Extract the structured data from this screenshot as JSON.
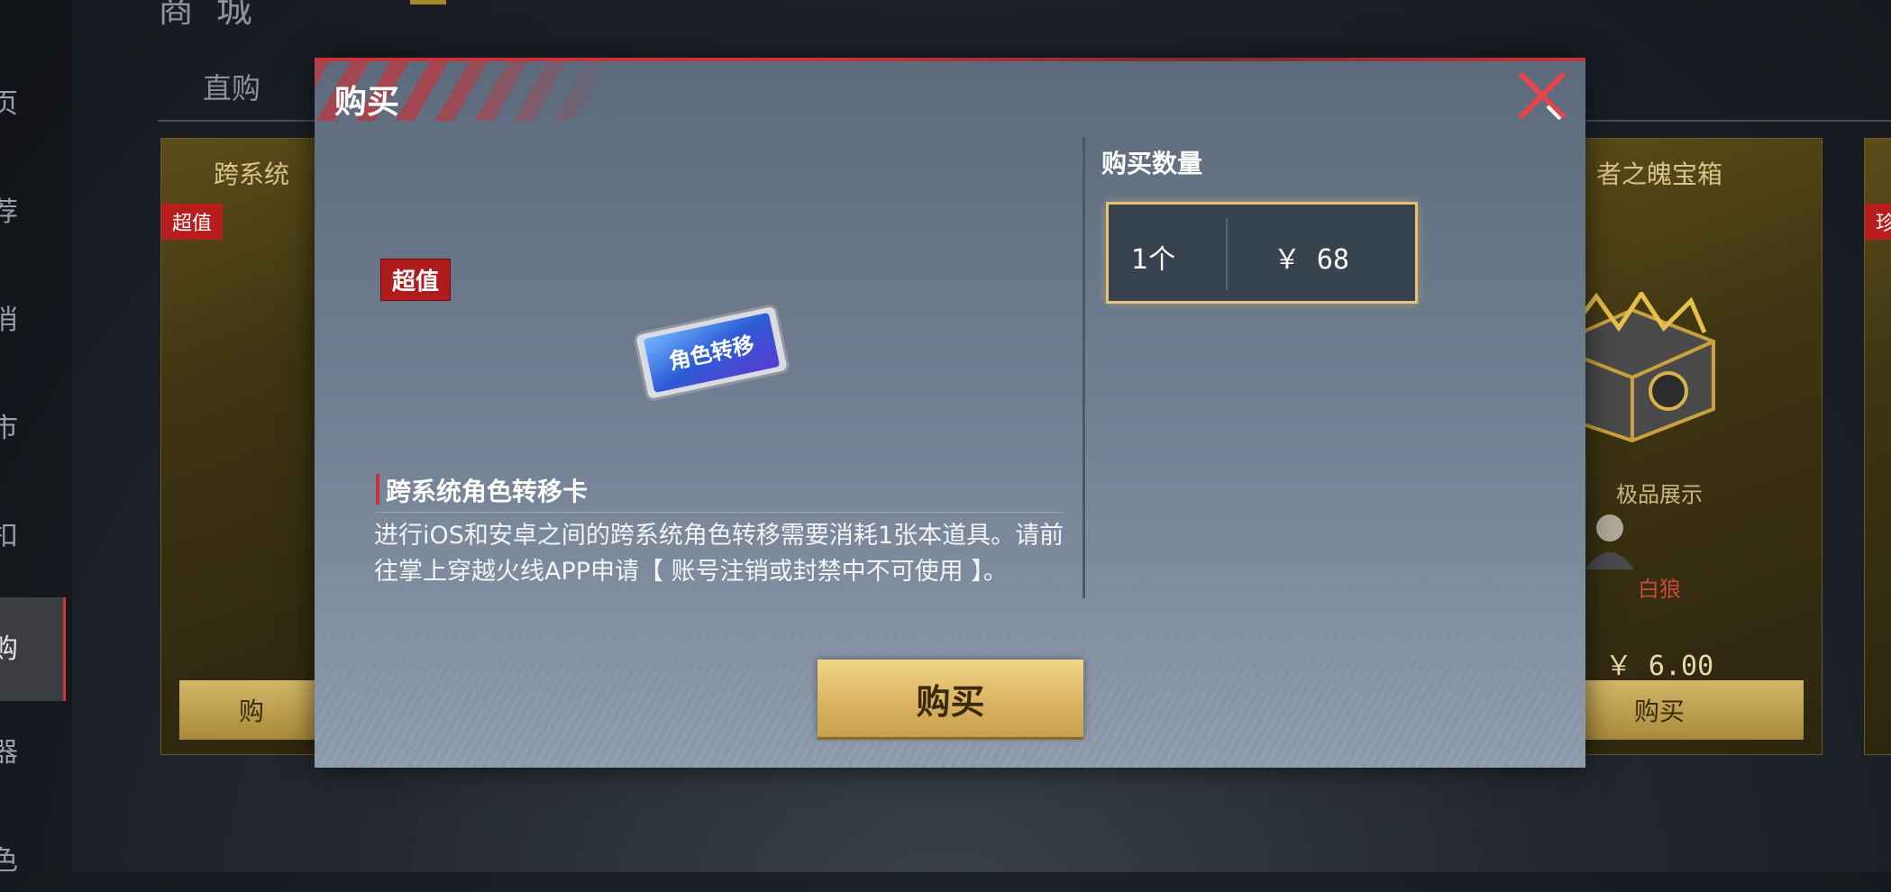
{
  "background": {
    "title": "商 城",
    "sidebar": [
      "页",
      "荐",
      "消",
      "市",
      "扣",
      "购",
      "器",
      "色"
    ],
    "sidebar_active": 5,
    "tab": "直购",
    "cards": [
      {
        "title": "跨系统",
        "badge": "超值",
        "button": "购"
      },
      {
        "title": "者之魄宝箱",
        "sub": "极品展示",
        "red_name": "白狼",
        "price": "￥ 6.00",
        "button": "购买"
      },
      {
        "badge": "珍"
      }
    ]
  },
  "modal": {
    "title": "购买",
    "badge": "超值",
    "item_image_text": "角色转移",
    "item_name": "跨系统角色转移卡",
    "item_description": "进行iOS和安卓之间的跨系统角色转移需要消耗1张本道具。请前往掌上穿越火线APP申请【 账号注销或封禁中不可使用 】。",
    "quantity_label": "购买数量",
    "quantity": "1个",
    "price": "￥ 68",
    "buy_button": "购买"
  },
  "colors": {
    "accent_red": "#c8323a",
    "gold": "#e9c27a",
    "badge_red": "#b01c1c"
  }
}
